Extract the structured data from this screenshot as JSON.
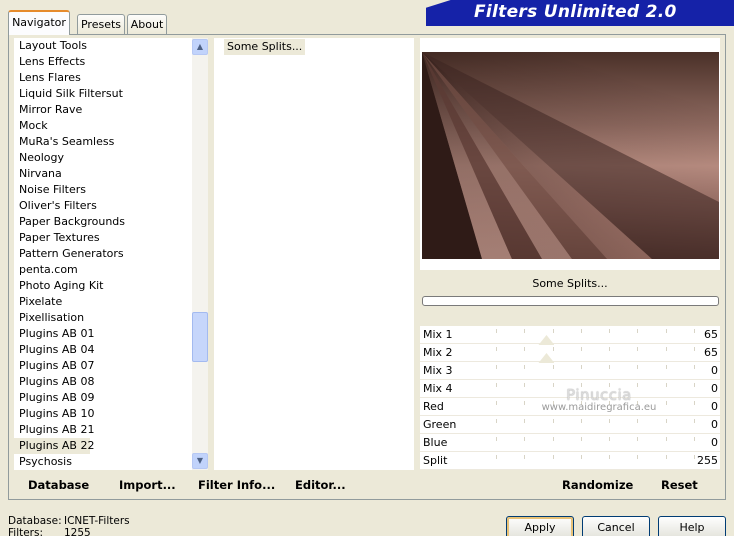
{
  "window": {
    "title": "Filters Unlimited 2.0"
  },
  "tabs": [
    {
      "label": "Navigator",
      "active": true
    },
    {
      "label": "Presets",
      "active": false
    },
    {
      "label": "About",
      "active": false
    }
  ],
  "categories": {
    "items": [
      "Layout Tools",
      "Lens Effects",
      "Lens Flares",
      "Liquid Silk Filtersut",
      "Mirror Rave",
      "Mock",
      "MuRa's Seamless",
      "Neology",
      "Nirvana",
      "Noise Filters",
      "Oliver's Filters",
      "Paper Backgrounds",
      "Paper Textures",
      "Pattern Generators",
      "penta.com",
      "Photo Aging Kit",
      "Pixelate",
      "Pixellisation",
      "Plugins AB 01",
      "Plugins AB 04",
      "Plugins AB 07",
      "Plugins AB 08",
      "Plugins AB 09",
      "Plugins AB 10",
      "Plugins AB 21",
      "Plugins AB 22",
      "Psychosis"
    ],
    "selected": "Plugins AB 22"
  },
  "filters": {
    "items": [
      "Some Splits..."
    ],
    "selected": "Some Splits..."
  },
  "preview": {
    "filter_name": "Some Splits...",
    "progress": 0
  },
  "sliders": [
    {
      "label": "Mix 1",
      "value": "65",
      "fraction": 0.255
    },
    {
      "label": "Mix 2",
      "value": "65",
      "fraction": 0.255
    },
    {
      "label": "Mix 3",
      "value": "0"
    },
    {
      "label": "Mix 4",
      "value": "0"
    },
    {
      "label": "Red",
      "value": "0"
    },
    {
      "label": "Green",
      "value": "0"
    },
    {
      "label": "Blue",
      "value": "0"
    },
    {
      "label": "Split",
      "value": "255"
    }
  ],
  "watermark": {
    "title": "Pinuccia",
    "url": "www.maidiregrafica.eu"
  },
  "actions_left": {
    "database": "Database",
    "import": "Import...",
    "filter_info": "Filter Info...",
    "editor": "Editor..."
  },
  "actions_right": {
    "randomize": "Randomize",
    "reset": "Reset"
  },
  "status": {
    "database_label": "Database:",
    "database_value": "ICNET-Filters",
    "filters_label": "Filters:",
    "filters_value": "1255"
  },
  "dialog_buttons": {
    "apply": "Apply",
    "cancel": "Cancel",
    "help": "Help"
  },
  "colors": {
    "banner": "#1522a8",
    "dialog_bg": "#ece9d8",
    "preview_base": "#8e6a60"
  }
}
